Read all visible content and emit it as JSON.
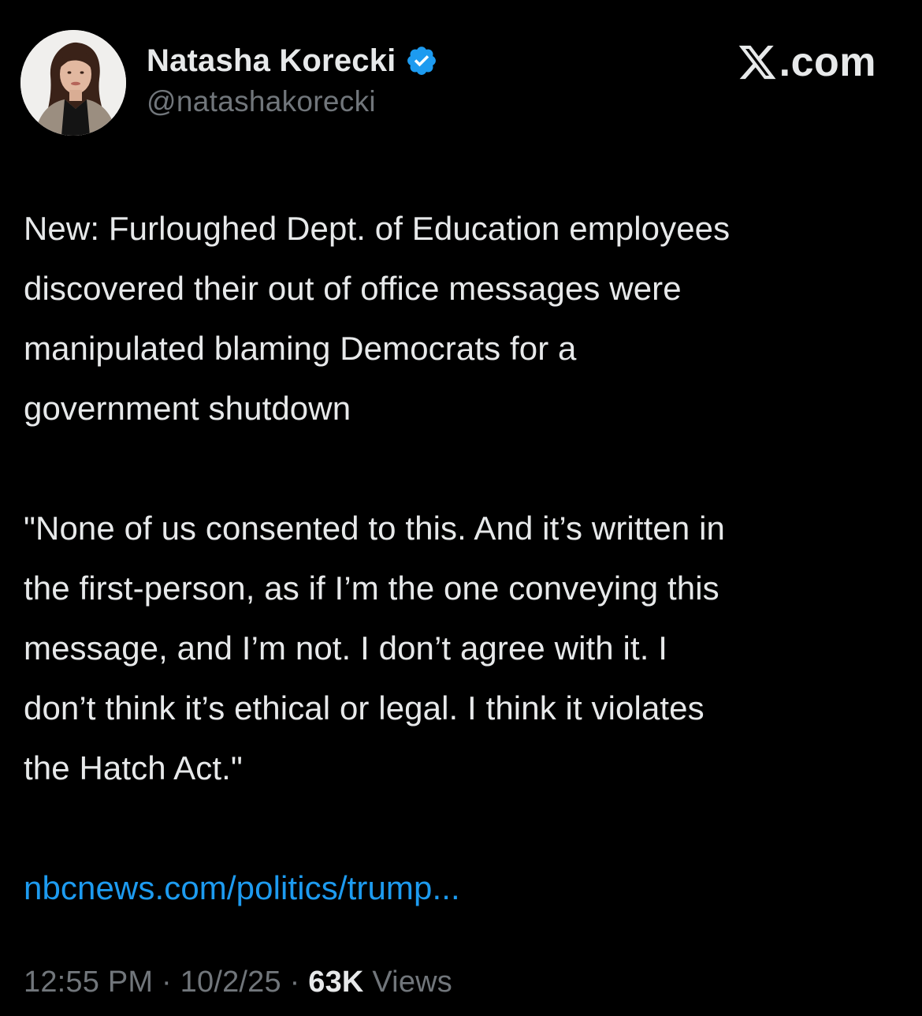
{
  "author": {
    "display_name": "Natasha Korecki",
    "handle": "@natashakorecki",
    "verified_icon": "verified-badge-icon",
    "avatar_icon": "profile-photo"
  },
  "brand": {
    "icon": "x-logo-icon",
    "text": ".com"
  },
  "tweet": {
    "paragraph_1": "New: Furloughed Dept. of Education employees\ndiscovered their out of office messages were\nmanipulated blaming Democrats for a\ngovernment shutdown",
    "paragraph_2": "\"None of us consented to this. And it’s written in\nthe first-person, as if I’m the one conveying this\nmessage, and I’m not. I don’t agree with it. I\ndon’t think it’s ethical or legal. I think it violates\nthe Hatch Act.\"",
    "link_text": "nbcnews.com/politics/trump..."
  },
  "meta": {
    "time": "12:55 PM",
    "separator": "·",
    "date": "10/2/25",
    "views_count": "63K",
    "views_label": "Views"
  },
  "colors": {
    "background": "#000000",
    "text_primary": "#e7e9ea",
    "text_secondary": "#71767b",
    "link": "#1d9bf0",
    "verified": "#1d9bf0"
  }
}
